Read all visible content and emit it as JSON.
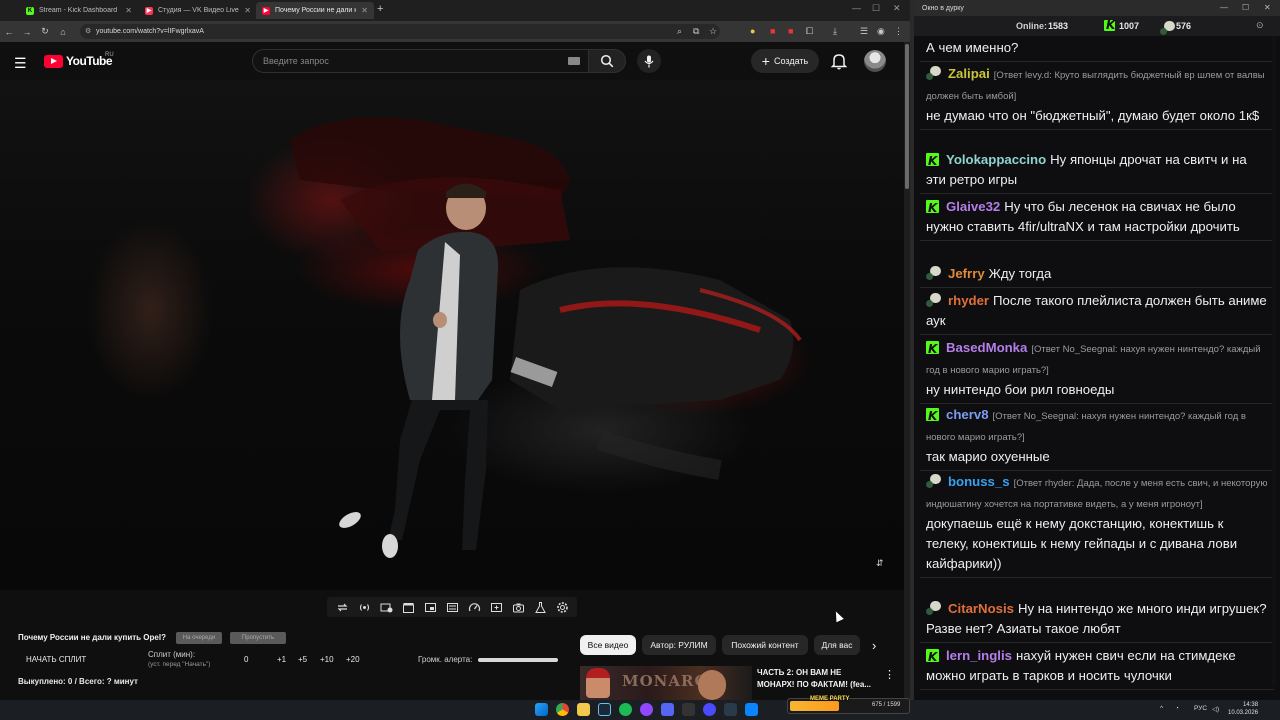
{
  "browser": {
    "tabs": [
      {
        "label": "Stream - Kick Dashboard",
        "favicon": "kick-icon",
        "color": "#53fc18"
      },
      {
        "label": "Студия — VK Видео Live",
        "favicon": "vk-video-icon",
        "color": "#ff3355"
      },
      {
        "label": "Почему России не дали купи...",
        "favicon": "youtube-icon",
        "color": "#ff0033"
      }
    ],
    "url": "youtube.com/watch?v=lIFwgrlxavA"
  },
  "youtube": {
    "logo": "YouTube",
    "region": "RU",
    "search_placeholder": "Введите запрос",
    "create_label": "Создать"
  },
  "stream_widget": {
    "video_title": "Почему России не дали купить Opel?",
    "pill_1": "На очереди",
    "pill_2": "Пропустить",
    "start_split": "НАЧАТЬ СПЛИТ",
    "split_label": "Сплит (мин):",
    "split_hint": "(уст. перед \"Начать\")",
    "split_value": "0",
    "increments": [
      "+1",
      "+5",
      "+10",
      "+20"
    ],
    "alert_volume_label": "Громк. алерта:",
    "alert_volume": 1.0,
    "status": "Выкуплено: 0 / Всего: ? минут"
  },
  "chips": [
    "Все видео",
    "Автор: РУЛИМ",
    "Похожий контент",
    "Для вас"
  ],
  "recommendation": {
    "thumb_word": "MONARCH",
    "title": "ЧАСТЬ 2: ОН ВАМ НЕ МОНАРХ! ПО ФАКТАМ! (fea..."
  },
  "chat": {
    "window_title": "Окно в дурку",
    "online_label": "Online:",
    "online": "1583",
    "kick_count": "1007",
    "vk_count": "576",
    "colors": {
      "kick": "#53fc18"
    },
    "messages": [
      {
        "platform": "none",
        "user": "",
        "color": "#ffffff",
        "reply": "",
        "text": "А чем именно?"
      },
      {
        "platform": "vk",
        "user": "Zalipai",
        "color": "#c9c53a",
        "reply": "[Ответ levy.d: Круто выглядить бюджетный вр шлем от валвы должен быть имбой]",
        "text": "не думаю что он \"бюджетный\", думаю будет около 1к$"
      },
      {
        "platform": "kick",
        "user": "Yolokappaccino",
        "color": "#8fd4cf",
        "reply": "",
        "text": "Ну японцы дрочат на свитч и на эти ретро игры"
      },
      {
        "platform": "kick",
        "user": "Glaive32",
        "color": "#b57ee8",
        "reply": "",
        "text": "Ну что бы лесенок на свичах не было нужно ставить 4fir/ultraNX и там настройки дрочить"
      },
      {
        "platform": "vk",
        "user": "Jefrry",
        "color": "#e08a3a",
        "reply": "",
        "text": "Жду тогда"
      },
      {
        "platform": "vk",
        "user": "rhyder",
        "color": "#e0703a",
        "reply": "",
        "text": "После такого плейлиста должен быть аниме аук"
      },
      {
        "platform": "kick",
        "user": "BasedMonka",
        "color": "#b57ee8",
        "reply": "[Ответ No_Seegnal: нахуя нужен нинтендо? каждый год в нового марио играть?]",
        "text": "ну нинтендо бои рил говноеды"
      },
      {
        "platform": "kick",
        "user": "cherv8",
        "color": "#7b9cf0",
        "reply": "[Ответ No_Seegnal: нахуя нужен нинтендо? каждый год в нового марио играть?]",
        "text": "так марио охуенные"
      },
      {
        "platform": "vk",
        "user": "bonuss_s",
        "color": "#3aa0f0",
        "reply": "[Ответ rhyder: Дада, после у меня есть свич, и некоторую индюшатину хочется на портативке видеть, а у меня игроноут]",
        "text": "докупаешь ещё к нему докстанцию, конектишь к телеку, конектишь к нему гейпады и с дивана лови кайфарики))"
      },
      {
        "platform": "vk",
        "user": "CitarNosis",
        "color": "#e0703a",
        "reply": "",
        "text": "Ну на нинтендо же много инди игрушек? Разве нет? Азиаты такое любят"
      },
      {
        "platform": "kick",
        "user": "lern_inglis",
        "color": "#b57ee8",
        "reply": "",
        "text": "нахуй нужен свич если на стимдеке можно играть в тарков и носить чулочки"
      }
    ]
  },
  "taskbar": {
    "meme_label": "MEME PARTY",
    "meme_progress": "675 / 1599",
    "meme_fraction": 0.42,
    "lang": "РУС",
    "time": "14:38",
    "date": "10.03.2026"
  }
}
